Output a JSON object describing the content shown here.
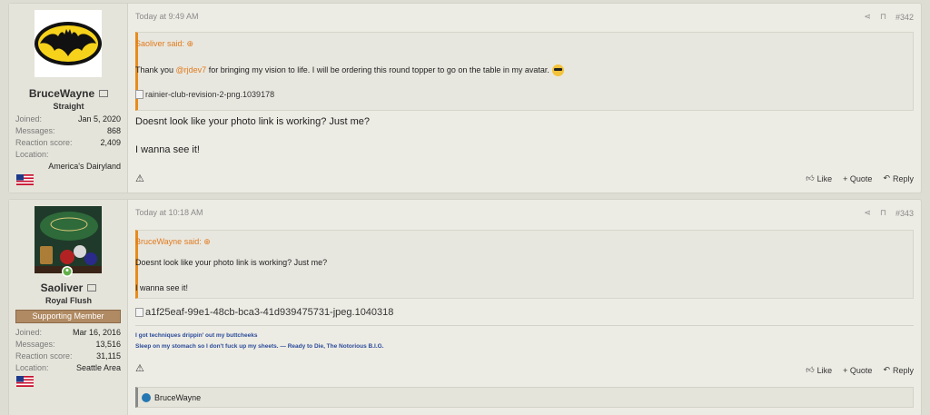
{
  "posts": [
    {
      "user": {
        "name": "BruceWayne",
        "title": "Straight",
        "banner": "",
        "stats": [
          {
            "k": "Joined:",
            "v": "Jan 5, 2020"
          },
          {
            "k": "Messages:",
            "v": "868"
          },
          {
            "k": "Reaction score:",
            "v": "2,409"
          }
        ],
        "location_label": "Location:",
        "location": "America's Dairyland",
        "avatar_icon": "batman-logo-icon"
      },
      "time": "Today at 9:49 AM",
      "number": "#342",
      "quote": {
        "header": "Saoliver said: ⊕",
        "text_before": "Thank you ",
        "mention": "@rjdev7",
        "text_after": " for bringing my vision to life. I will be ordering this round topper to go on the table in my avatar.",
        "image_alt": "rainier-club-revision-2-png.1039178"
      },
      "message_lines": [
        "Doesnt look like your photo link is working? Just me?",
        "I wanna see it!"
      ],
      "actions": {
        "like": "Like",
        "quote": "+ Quote",
        "reply": "Reply"
      }
    },
    {
      "user": {
        "name": "Saoliver",
        "title": "Royal Flush",
        "banner": "Supporting Member",
        "stats": [
          {
            "k": "Joined:",
            "v": "Mar 16, 2016"
          },
          {
            "k": "Messages:",
            "v": "13,516"
          },
          {
            "k": "Reaction score:",
            "v": "31,115"
          }
        ],
        "location_label": "Location:",
        "location": "Seattle Area",
        "avatar_icon": "poker-table-photo-icon"
      },
      "time": "Today at 10:18 AM",
      "number": "#343",
      "quote": {
        "header": "BruceWayne said: ⊕",
        "line1": "Doesnt look like your photo link is working? Just me?",
        "line2": "I wanna see it!"
      },
      "image_alt": "a1f25eaf-99e1-48cb-bca3-41d939475731-jpeg.1040318",
      "signature": {
        "line1": "I got techniques drippin' out my buttcheeks",
        "line2": "Sleep on my stomach so I don't fuck up my sheets. — Ready to Die, The Notorious B.I.G."
      },
      "actions": {
        "like": "Like",
        "quote": "+ Quote",
        "reply": "Reply"
      },
      "reaction_user": "BruceWayne"
    }
  ]
}
